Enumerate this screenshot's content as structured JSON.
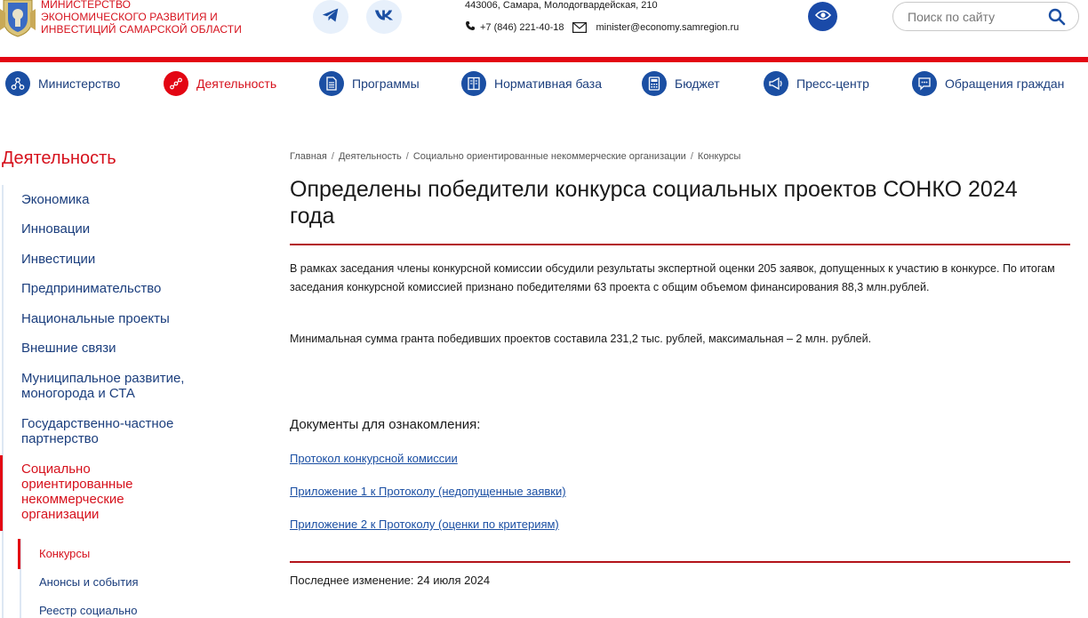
{
  "header": {
    "logo_lines": [
      "МИНИСТЕРСТВО",
      "ЭКОНОМИЧЕСКОГО РАЗВИТИЯ И",
      "ИНВЕСТИЦИЙ САМАРСКОЙ ОБЛАСТИ"
    ],
    "address": "443006, Самара, Молодогвардейская, 210",
    "phone": "+7 (846) 221-40-18",
    "email": "minister@economy.samregion.ru",
    "search_placeholder": "Поиск по сайту",
    "social_icons": [
      "telegram-icon",
      "vk-icon"
    ],
    "accessibility_icon": "eye-icon"
  },
  "colors": {
    "brand_red": "#e30613",
    "brand_blue": "#1b4fa3",
    "link_blue": "#1b3e7d"
  },
  "nav": {
    "items": [
      {
        "label": "Министерство",
        "icon": "network-icon"
      },
      {
        "label": "Деятельность",
        "icon": "chain-icon",
        "active": true
      },
      {
        "label": "Программы",
        "icon": "document-icon"
      },
      {
        "label": "Нормативная база",
        "icon": "book-icon"
      },
      {
        "label": "Бюджет",
        "icon": "calculator-icon"
      },
      {
        "label": "Пресс-центр",
        "icon": "megaphone-icon"
      },
      {
        "label": "Обращения граждан",
        "icon": "chat-icon"
      }
    ]
  },
  "sidebar": {
    "title": "Деятельность",
    "items": [
      {
        "label": "Экономика"
      },
      {
        "label": "Инновации"
      },
      {
        "label": "Инвестиции"
      },
      {
        "label": "Предпринимательство"
      },
      {
        "label": "Национальные проекты"
      },
      {
        "label": "Внешние связи"
      },
      {
        "label": "Муниципальное развитие, моногорода и СТА"
      },
      {
        "label": "Государственно-частное партнерство"
      },
      {
        "label": "Социально ориентированные некоммерческие организации",
        "active": true
      }
    ],
    "subitems": [
      {
        "label": "Конкурсы",
        "active": true
      },
      {
        "label": "Анонсы и события"
      },
      {
        "label": "Реестр социально"
      }
    ]
  },
  "breadcrumb": [
    "Главная",
    "Деятельность",
    "Социально ориентированные некоммерческие организации",
    "Конкурсы"
  ],
  "article": {
    "title": "Определены победители конкурса социальных проектов СОНКО 2024 года",
    "paragraphs": [
      "В рамках заседания члены конкурсной комиссии обсудили результаты экспертной оценки 205 заявок, допущенных к участию в конкурсе. По итогам заседания конкурсной комиссией признано победителями 63 проекта с общим объемом финансирования 88,3 млн.рублей.",
      "Минимальная сумма гранта победивших проектов составила 231,2 тыс. рублей, максимальная – 2 млн. рублей."
    ],
    "docs_title": "Документы для ознакомления:",
    "docs": [
      "Протокол конкурсной комиссии",
      "Приложение 1 к Протоколу (недопущенные заявки)",
      "Приложение 2 к Протоколу (оценки по критериям)"
    ],
    "last_modified": "Последнее изменение: 24 июля 2024"
  }
}
